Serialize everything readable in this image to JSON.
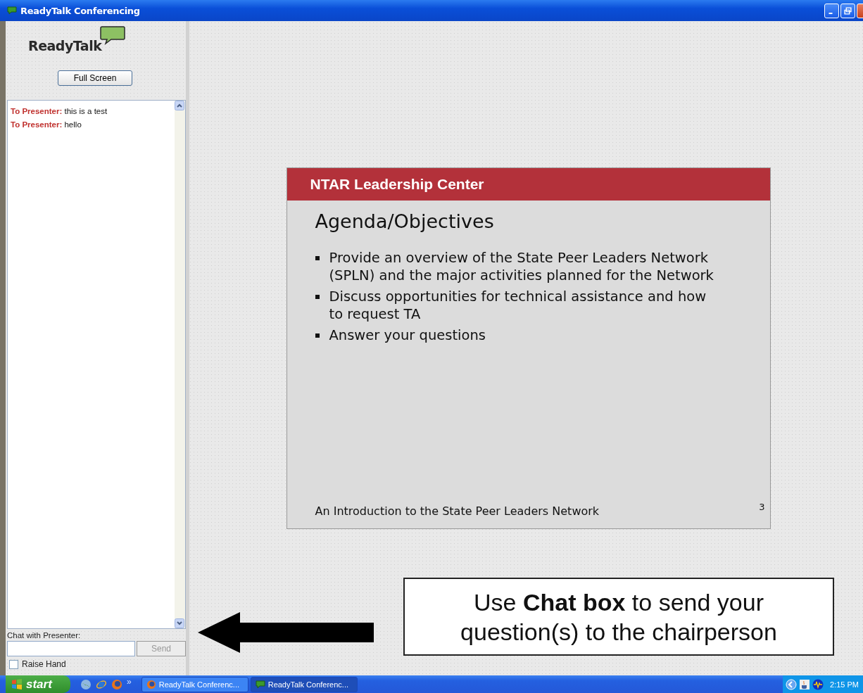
{
  "window": {
    "title": "ReadyTalk Conferencing"
  },
  "sidebar": {
    "logo": "ReadyTalk",
    "full_screen_button": "Full Screen",
    "chat_messages": [
      "**To Presenter:** this is a test",
      "**To Presenter:** hello"
    ],
    "chat_label": "Chat with Presenter:",
    "send_button": {
      "label": "Send",
      "disabled": true
    },
    "raise_hand": {
      "label": "Raise Hand",
      "checked": false
    }
  },
  "slide": {
    "header": "NTAR Leadership Center",
    "title": "Agenda/Objectives",
    "bullets": [
      "Provide an overview of the State Peer Leaders Network (SPLN) and the major activities planned for the Network",
      "Discuss opportunities for technical assistance and how to request TA",
      "Answer your questions"
    ],
    "footer": "An Introduction to the State Peer Leaders Network",
    "page_number": "3"
  },
  "callout": {
    "text": "Use **Chat box** to send your question(s) to the chairperson"
  },
  "taskbar": {
    "start": "start",
    "more": "»",
    "tasks": [
      {
        "label": "ReadyTalk Conferenc...",
        "kind": "browser",
        "selected": false
      },
      {
        "label": "ReadyTalk Conferenc...",
        "kind": "chat",
        "selected": true
      }
    ],
    "clock": "2:15 PM"
  }
}
